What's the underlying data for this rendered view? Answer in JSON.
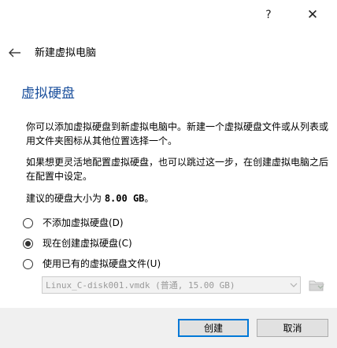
{
  "window": {
    "help_label": "?",
    "close_label": "✕"
  },
  "header": {
    "back_icon": "arrow-left-icon",
    "title": "新建虚拟电脑"
  },
  "page": {
    "title": "虚拟硬盘",
    "paragraph1": "你可以添加虚拟硬盘到新虚拟电脑中。新建一个虚拟硬盘文件或从列表或用文件夹图标从其他位置选择一个。",
    "paragraph2": "如果想更灵活地配置虚拟硬盘，也可以跳过这一步，在创建虚拟电脑之后在配置中设定。",
    "recommended_prefix": "建议的硬盘大小为 ",
    "recommended_size": "8.00 GB",
    "recommended_suffix": "。"
  },
  "options": [
    {
      "label": "不添加虚拟硬盘(D)",
      "checked": false
    },
    {
      "label": "现在创建虚拟硬盘(C)",
      "checked": true
    },
    {
      "label": "使用已有的虚拟硬盘文件(U)",
      "checked": false
    }
  ],
  "file_select": {
    "value": "Linux_C-disk001.vmdk (普通, 15.00 GB)",
    "enabled": false,
    "folder_icon": "folder-icon"
  },
  "buttons": {
    "create": "创建",
    "cancel": "取消"
  },
  "colors": {
    "title_blue": "#1a4f9c",
    "default_button_border": "#0078d7",
    "footer_bg": "#f0f0f0"
  }
}
